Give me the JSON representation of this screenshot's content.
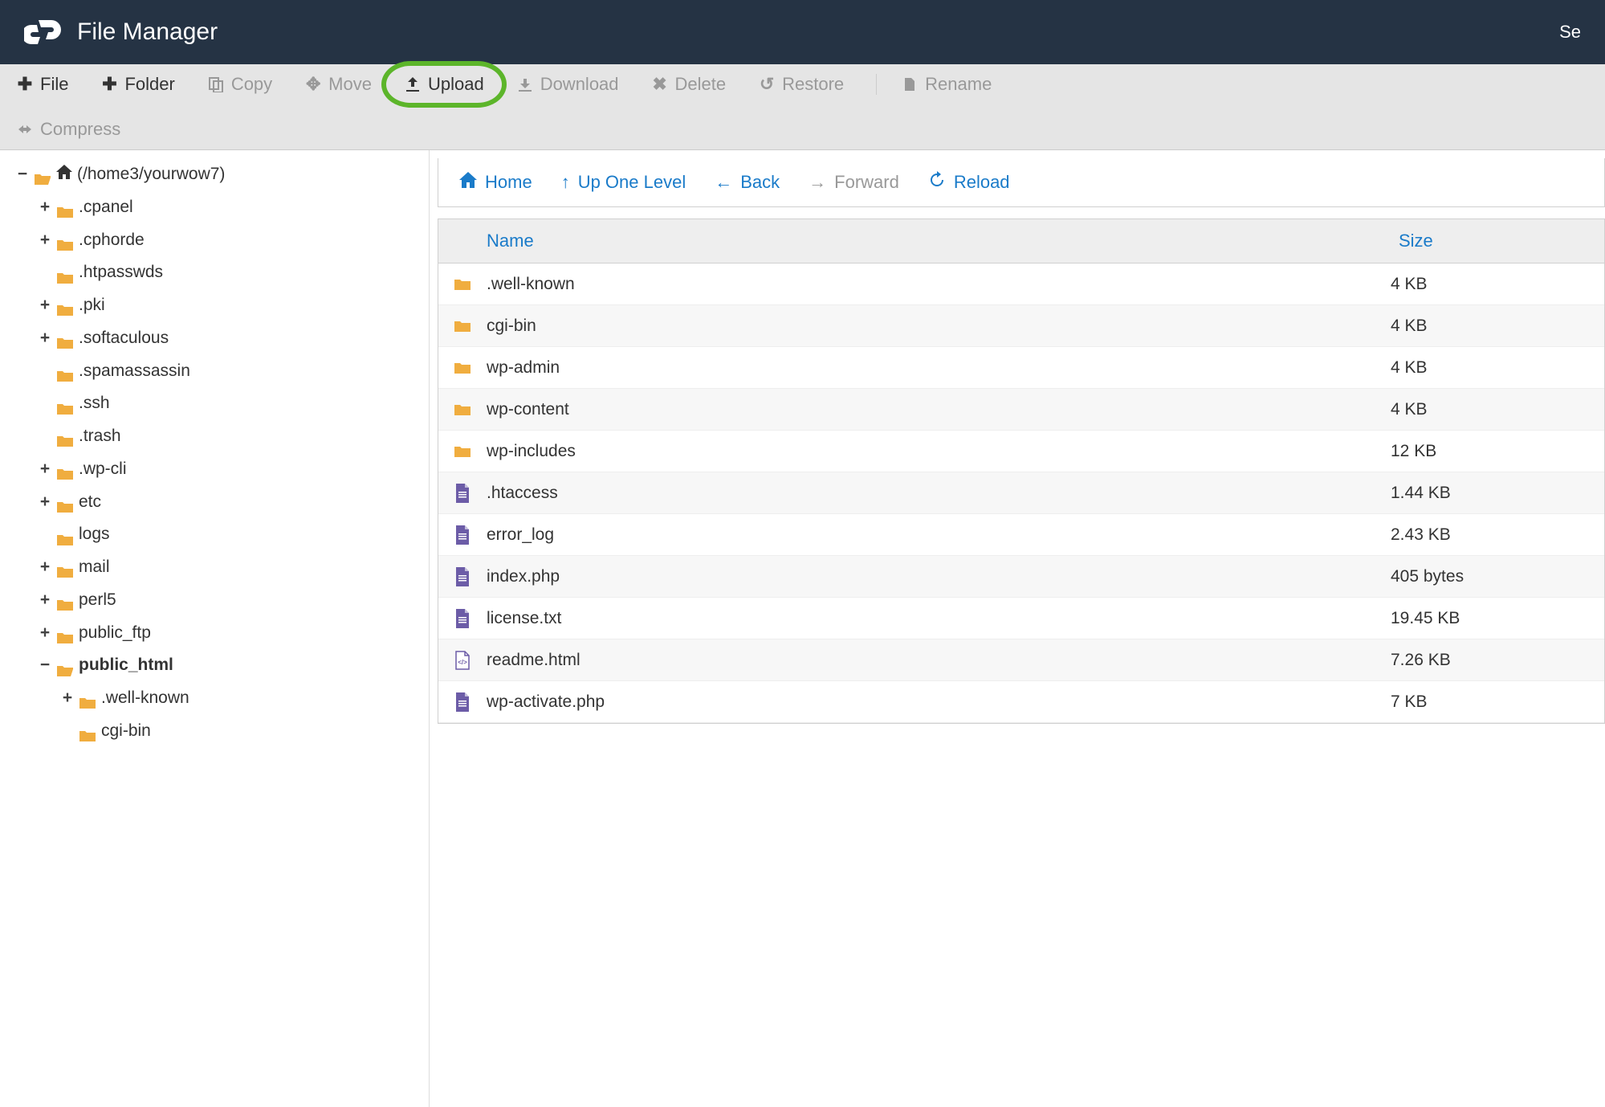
{
  "header": {
    "title": "File Manager",
    "right_text": "Se"
  },
  "toolbar": {
    "file": "File",
    "folder": "Folder",
    "copy": "Copy",
    "move": "Move",
    "upload": "Upload",
    "download": "Download",
    "delete": "Delete",
    "restore": "Restore",
    "rename": "Rename",
    "compress": "Compress"
  },
  "tree": {
    "root_label": "(/home3/yourwow7)",
    "items": [
      {
        "toggle": "+",
        "label": ".cpanel"
      },
      {
        "toggle": "+",
        "label": ".cphorde"
      },
      {
        "toggle": "",
        "label": ".htpasswds"
      },
      {
        "toggle": "+",
        "label": ".pki"
      },
      {
        "toggle": "+",
        "label": ".softaculous"
      },
      {
        "toggle": "",
        "label": ".spamassassin"
      },
      {
        "toggle": "",
        "label": ".ssh"
      },
      {
        "toggle": "",
        "label": ".trash"
      },
      {
        "toggle": "+",
        "label": ".wp-cli"
      },
      {
        "toggle": "+",
        "label": "etc"
      },
      {
        "toggle": "",
        "label": "logs"
      },
      {
        "toggle": "+",
        "label": "mail"
      },
      {
        "toggle": "+",
        "label": "perl5"
      },
      {
        "toggle": "+",
        "label": "public_ftp"
      }
    ],
    "public_html": {
      "toggle": "−",
      "label": "public_html",
      "children": [
        {
          "toggle": "+",
          "label": ".well-known"
        },
        {
          "toggle": "",
          "label": "cgi-bin"
        }
      ]
    }
  },
  "nav": {
    "home": "Home",
    "up": "Up One Level",
    "back": "Back",
    "forward": "Forward",
    "reload": "Reload"
  },
  "table": {
    "cols": {
      "name": "Name",
      "size": "Size"
    },
    "rows": [
      {
        "type": "folder",
        "name": ".well-known",
        "size": "4 KB"
      },
      {
        "type": "folder",
        "name": "cgi-bin",
        "size": "4 KB"
      },
      {
        "type": "folder",
        "name": "wp-admin",
        "size": "4 KB"
      },
      {
        "type": "folder",
        "name": "wp-content",
        "size": "4 KB"
      },
      {
        "type": "folder",
        "name": "wp-includes",
        "size": "12 KB"
      },
      {
        "type": "file",
        "name": ".htaccess",
        "size": "1.44 KB"
      },
      {
        "type": "file",
        "name": "error_log",
        "size": "2.43 KB"
      },
      {
        "type": "file",
        "name": "index.php",
        "size": "405 bytes"
      },
      {
        "type": "file",
        "name": "license.txt",
        "size": "19.45 KB"
      },
      {
        "type": "html",
        "name": "readme.html",
        "size": "7.26 KB"
      },
      {
        "type": "file",
        "name": "wp-activate.php",
        "size": "7 KB"
      }
    ]
  }
}
